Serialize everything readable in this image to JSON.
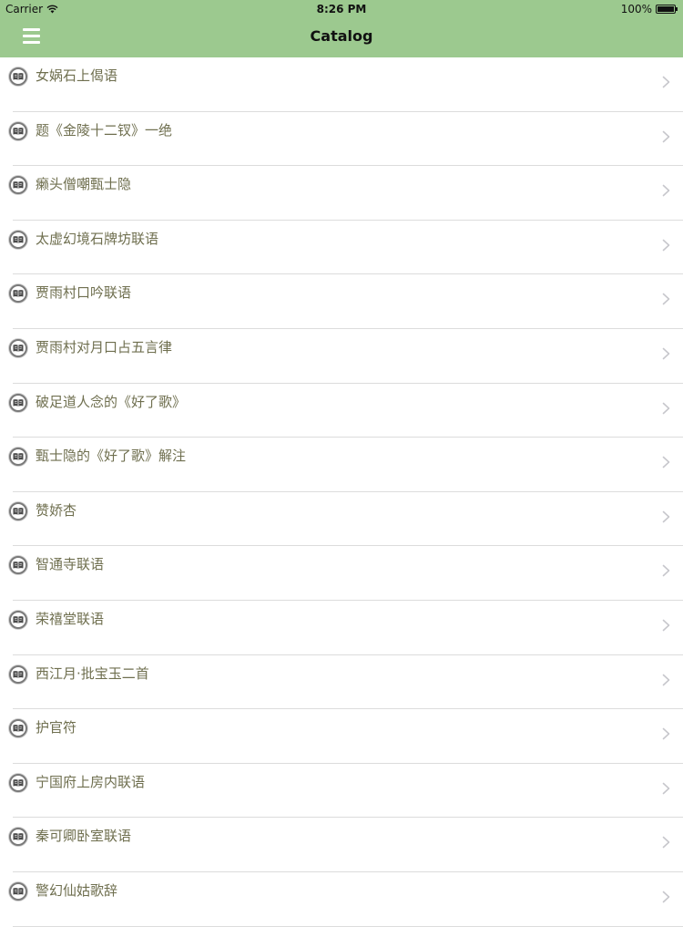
{
  "status_bar": {
    "carrier": "Carrier",
    "time": "8:26 PM",
    "battery": "100%"
  },
  "nav": {
    "title": "Catalog",
    "menu_icon": "hamburger-menu-icon"
  },
  "colors": {
    "nav_bar": "#9cc98f",
    "item_text": "#6f6f4f",
    "separator": "#dcdcdc"
  },
  "catalog": {
    "items": [
      {
        "label": "女娲石上偈语"
      },
      {
        "label": "题《金陵十二钗》一绝"
      },
      {
        "label": "癞头僧嘲甄士隐"
      },
      {
        "label": "太虚幻境石牌坊联语"
      },
      {
        "label": "贾雨村口吟联语"
      },
      {
        "label": "贾雨村对月口占五言律"
      },
      {
        "label": "破足道人念的《好了歌》"
      },
      {
        "label": "甄士隐的《好了歌》解注"
      },
      {
        "label": "赞娇杏"
      },
      {
        "label": "智通寺联语"
      },
      {
        "label": "荣禧堂联语"
      },
      {
        "label": "西江月·批宝玉二首"
      },
      {
        "label": "护官符"
      },
      {
        "label": "宁国府上房内联语"
      },
      {
        "label": "秦可卿卧室联语"
      },
      {
        "label": "警幻仙姑歌辞"
      }
    ]
  }
}
